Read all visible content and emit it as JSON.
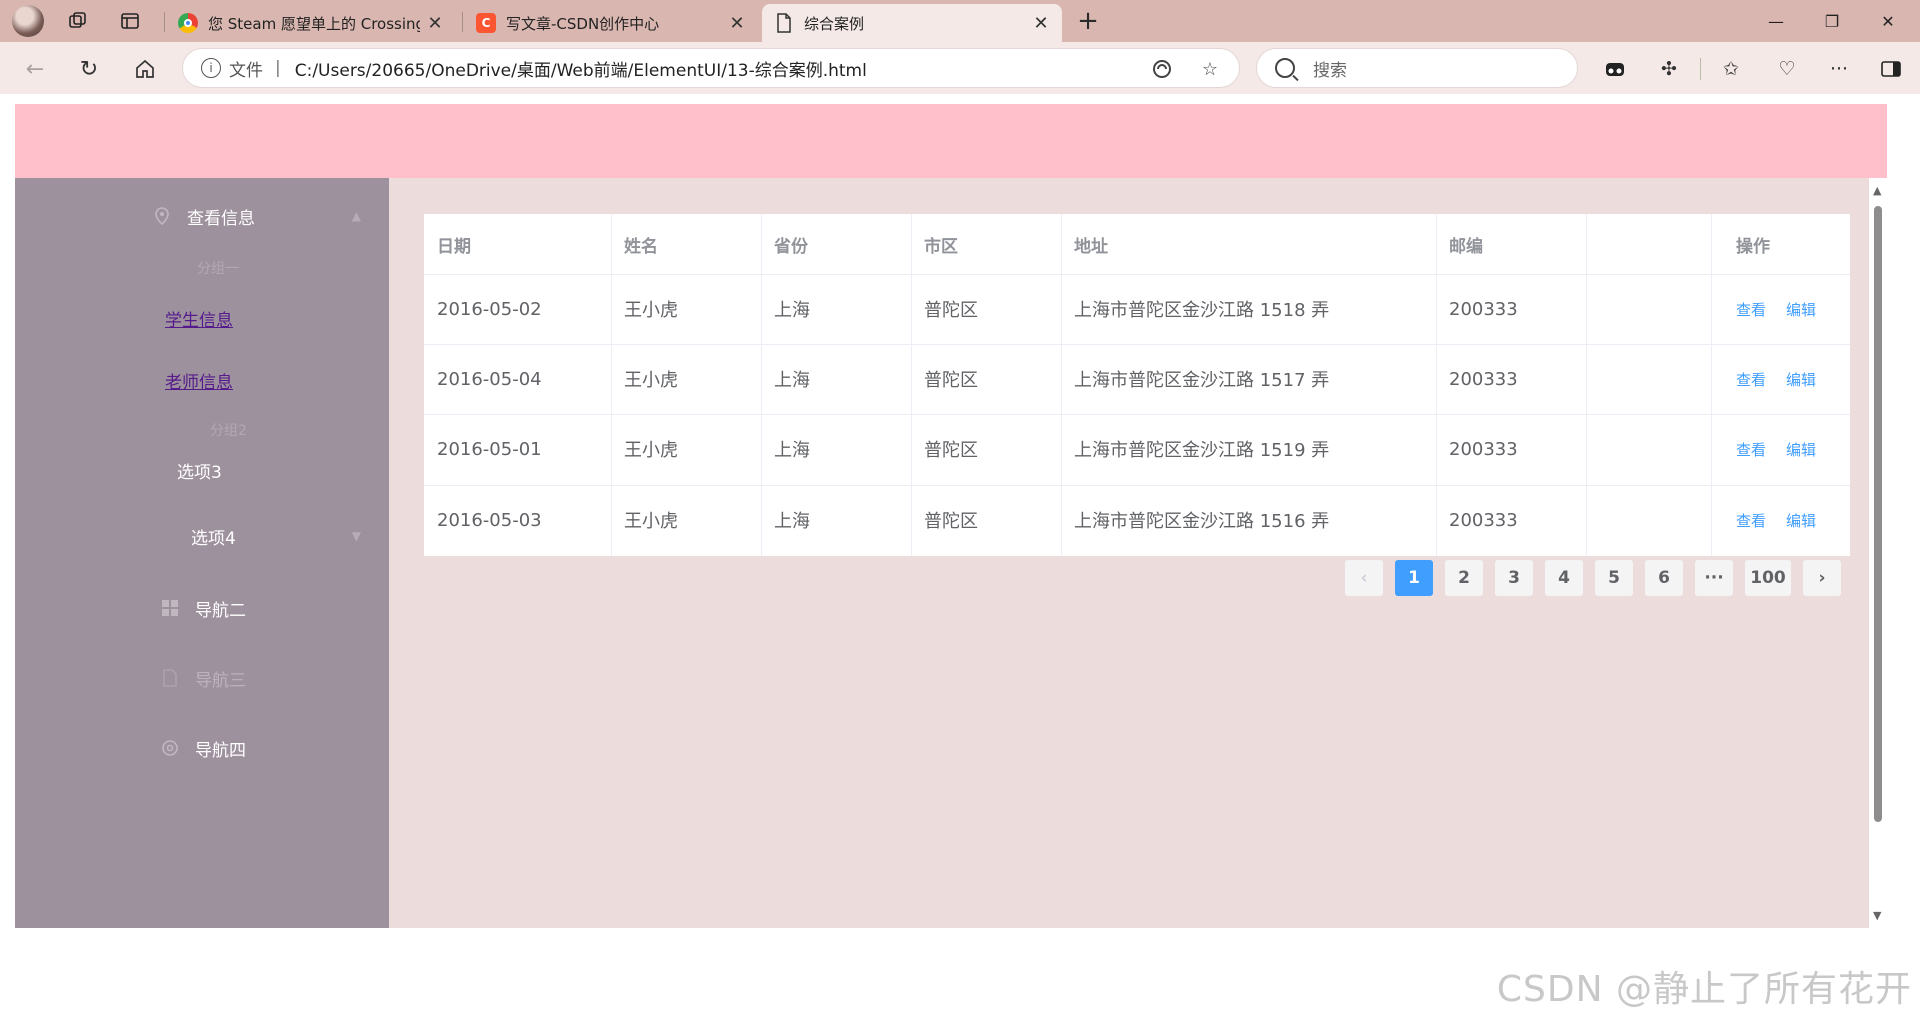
{
  "browser": {
    "tabs": [
      {
        "title": "您 Steam 愿望单上的 Crossing Gu",
        "favicon": "chrome-icon"
      },
      {
        "title": "写文章-CSDN创作中心",
        "favicon": "csdn-icon",
        "favicon_letter": "C"
      },
      {
        "title": "综合案例",
        "favicon": "document-icon",
        "active": true
      }
    ],
    "new_tab_glyph": "+",
    "address": {
      "protocol_label": "文件",
      "separator": "|",
      "url": "C:/Users/20665/OneDrive/桌面/Web前端/ElementUI/13-综合案例.html"
    },
    "search_placeholder": "搜索"
  },
  "sidebar": {
    "top_item": {
      "label": "查看信息",
      "icon": "location-icon"
    },
    "group_title": "分组一",
    "links": [
      "学生信息",
      "老师信息"
    ],
    "group2_title": "分组2",
    "option3": "选项3",
    "option4": "选项4",
    "nav_items": [
      {
        "label": "导航二",
        "icon": "menu-icon"
      },
      {
        "label": "导航三",
        "icon": "document-icon",
        "disabled": true
      },
      {
        "label": "导航四",
        "icon": "setting-icon"
      }
    ]
  },
  "table": {
    "columns": [
      "日期",
      "姓名",
      "省份",
      "市区",
      "地址",
      "邮编",
      "",
      "操作"
    ],
    "rows": [
      {
        "date": "2016-05-02",
        "name": "王小虎",
        "province": "上海",
        "city": "普陀区",
        "address": "上海市普陀区金沙江路 1518 弄",
        "zip": "200333"
      },
      {
        "date": "2016-05-04",
        "name": "王小虎",
        "province": "上海",
        "city": "普陀区",
        "address": "上海市普陀区金沙江路 1517 弄",
        "zip": "200333"
      },
      {
        "date": "2016-05-01",
        "name": "王小虎",
        "province": "上海",
        "city": "普陀区",
        "address": "上海市普陀区金沙江路 1519 弄",
        "zip": "200333"
      },
      {
        "date": "2016-05-03",
        "name": "王小虎",
        "province": "上海",
        "city": "普陀区",
        "address": "上海市普陀区金沙江路 1516 弄",
        "zip": "200333"
      }
    ],
    "actions": [
      "查看",
      "编辑"
    ]
  },
  "pagination": {
    "prev": "‹",
    "pages": [
      "1",
      "2",
      "3",
      "4",
      "5",
      "6"
    ],
    "ellipsis": "···",
    "last": "100",
    "next": "›",
    "current": "1"
  },
  "watermark": "CSDN @静止了所有花开",
  "colors": {
    "header": "#ffc0cb",
    "aside": "#9e919e",
    "main": "#eddcdc",
    "primary": "#409eff",
    "tabstrip": "#d9b7b0"
  }
}
